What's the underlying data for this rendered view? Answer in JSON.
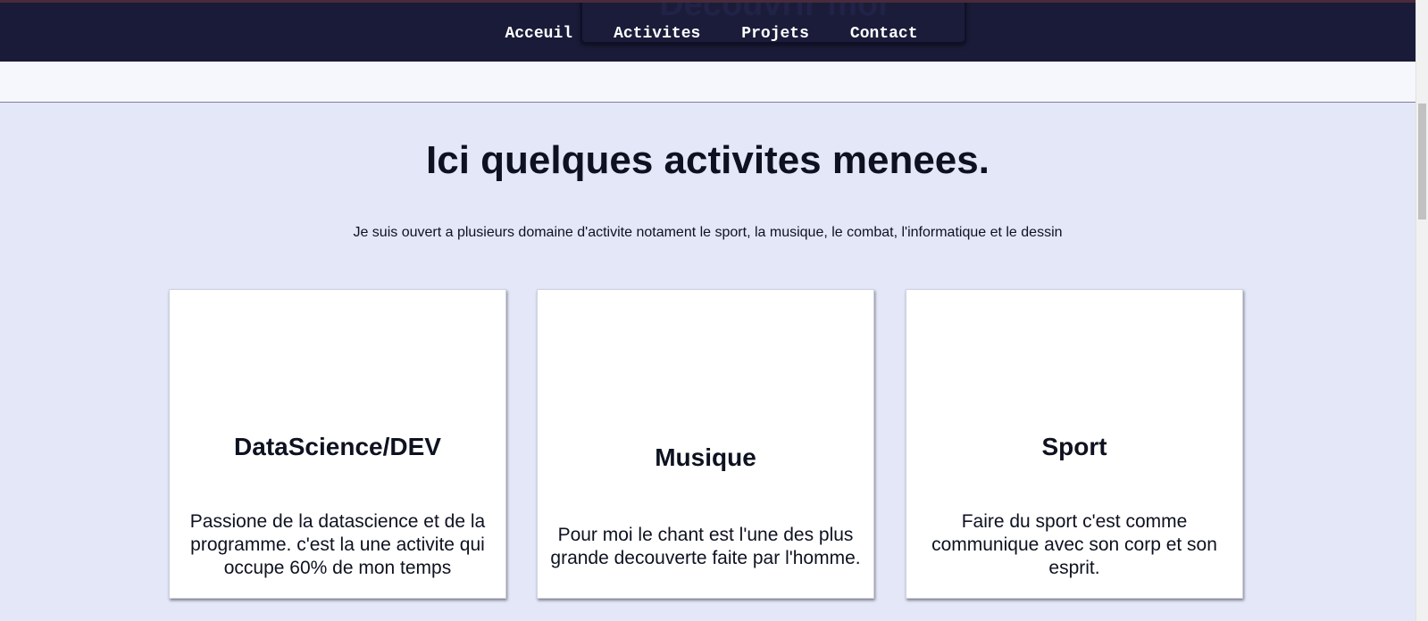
{
  "navbar": {
    "ghost_button_label": "Decouvrir moi",
    "links": [
      {
        "label": "Acceuil"
      },
      {
        "label": "Activites"
      },
      {
        "label": "Projets"
      },
      {
        "label": "Contact"
      }
    ]
  },
  "activities": {
    "title": "Ici quelques activites menees.",
    "subtitle": "Je suis ouvert a plusieurs domaine d'activite notament le sport, la musique, le combat, l'informatique et le dessin",
    "cards": [
      {
        "title": "DataScience/DEV",
        "text": "Passione de la datascience et de la programme. c'est la une activite qui occupe 60% de mon temps"
      },
      {
        "title": "Musique",
        "text": "Pour moi le chant est l'une des plus grande decouverte faite par l'homme."
      },
      {
        "title": "Sport",
        "text": "Faire du sport c'est comme communique avec son corp et son esprit."
      }
    ]
  },
  "colors": {
    "navbar_bg": "#191b38",
    "section_bg": "#e4e7f8",
    "band_bg": "#f6f7fc",
    "text_dark": "#0e1220",
    "card_bg": "#ffffff"
  }
}
